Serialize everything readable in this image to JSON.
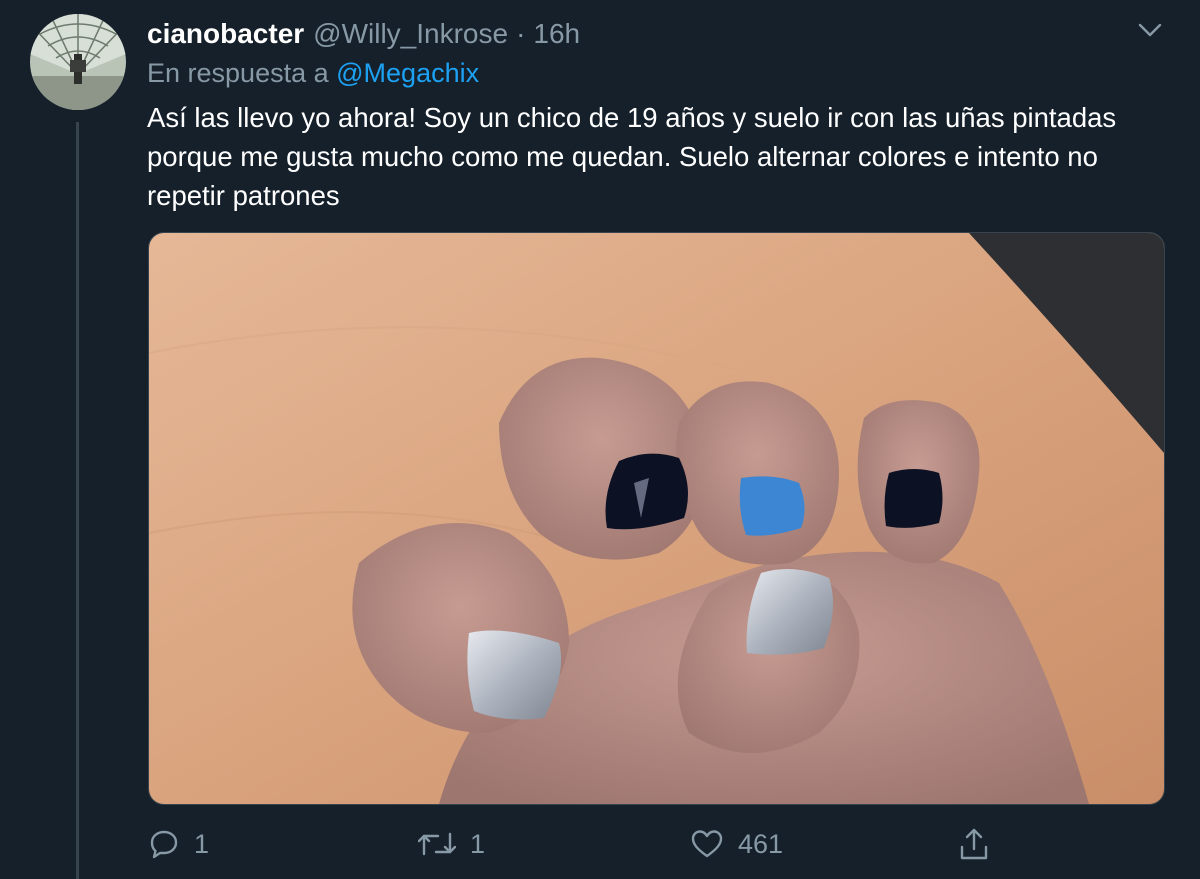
{
  "tweet": {
    "display_name": "cianobacter",
    "handle": "@Willy_Inkrose",
    "separator": "·",
    "time": "16h",
    "reply_prefix": "En respuesta a",
    "reply_mention": "@Megachix",
    "text": "Así las llevo yo ahora! Soy un chico de 19 años y suelo ir con las uñas pintadas porque me gusta mucho como me quedan. Suelo alternar colores e intento no repetir patrones"
  },
  "actions": {
    "reply_count": "1",
    "retweet_count": "1",
    "like_count": "461"
  },
  "icons": {
    "more": "chevron-down-icon",
    "reply": "speech-bubble-icon",
    "retweet": "retweet-icon",
    "like": "heart-icon",
    "share": "share-icon"
  },
  "colors": {
    "background": "#15202b",
    "secondary_text": "#8899a6",
    "link": "#1da1f2",
    "border": "#38444d"
  }
}
